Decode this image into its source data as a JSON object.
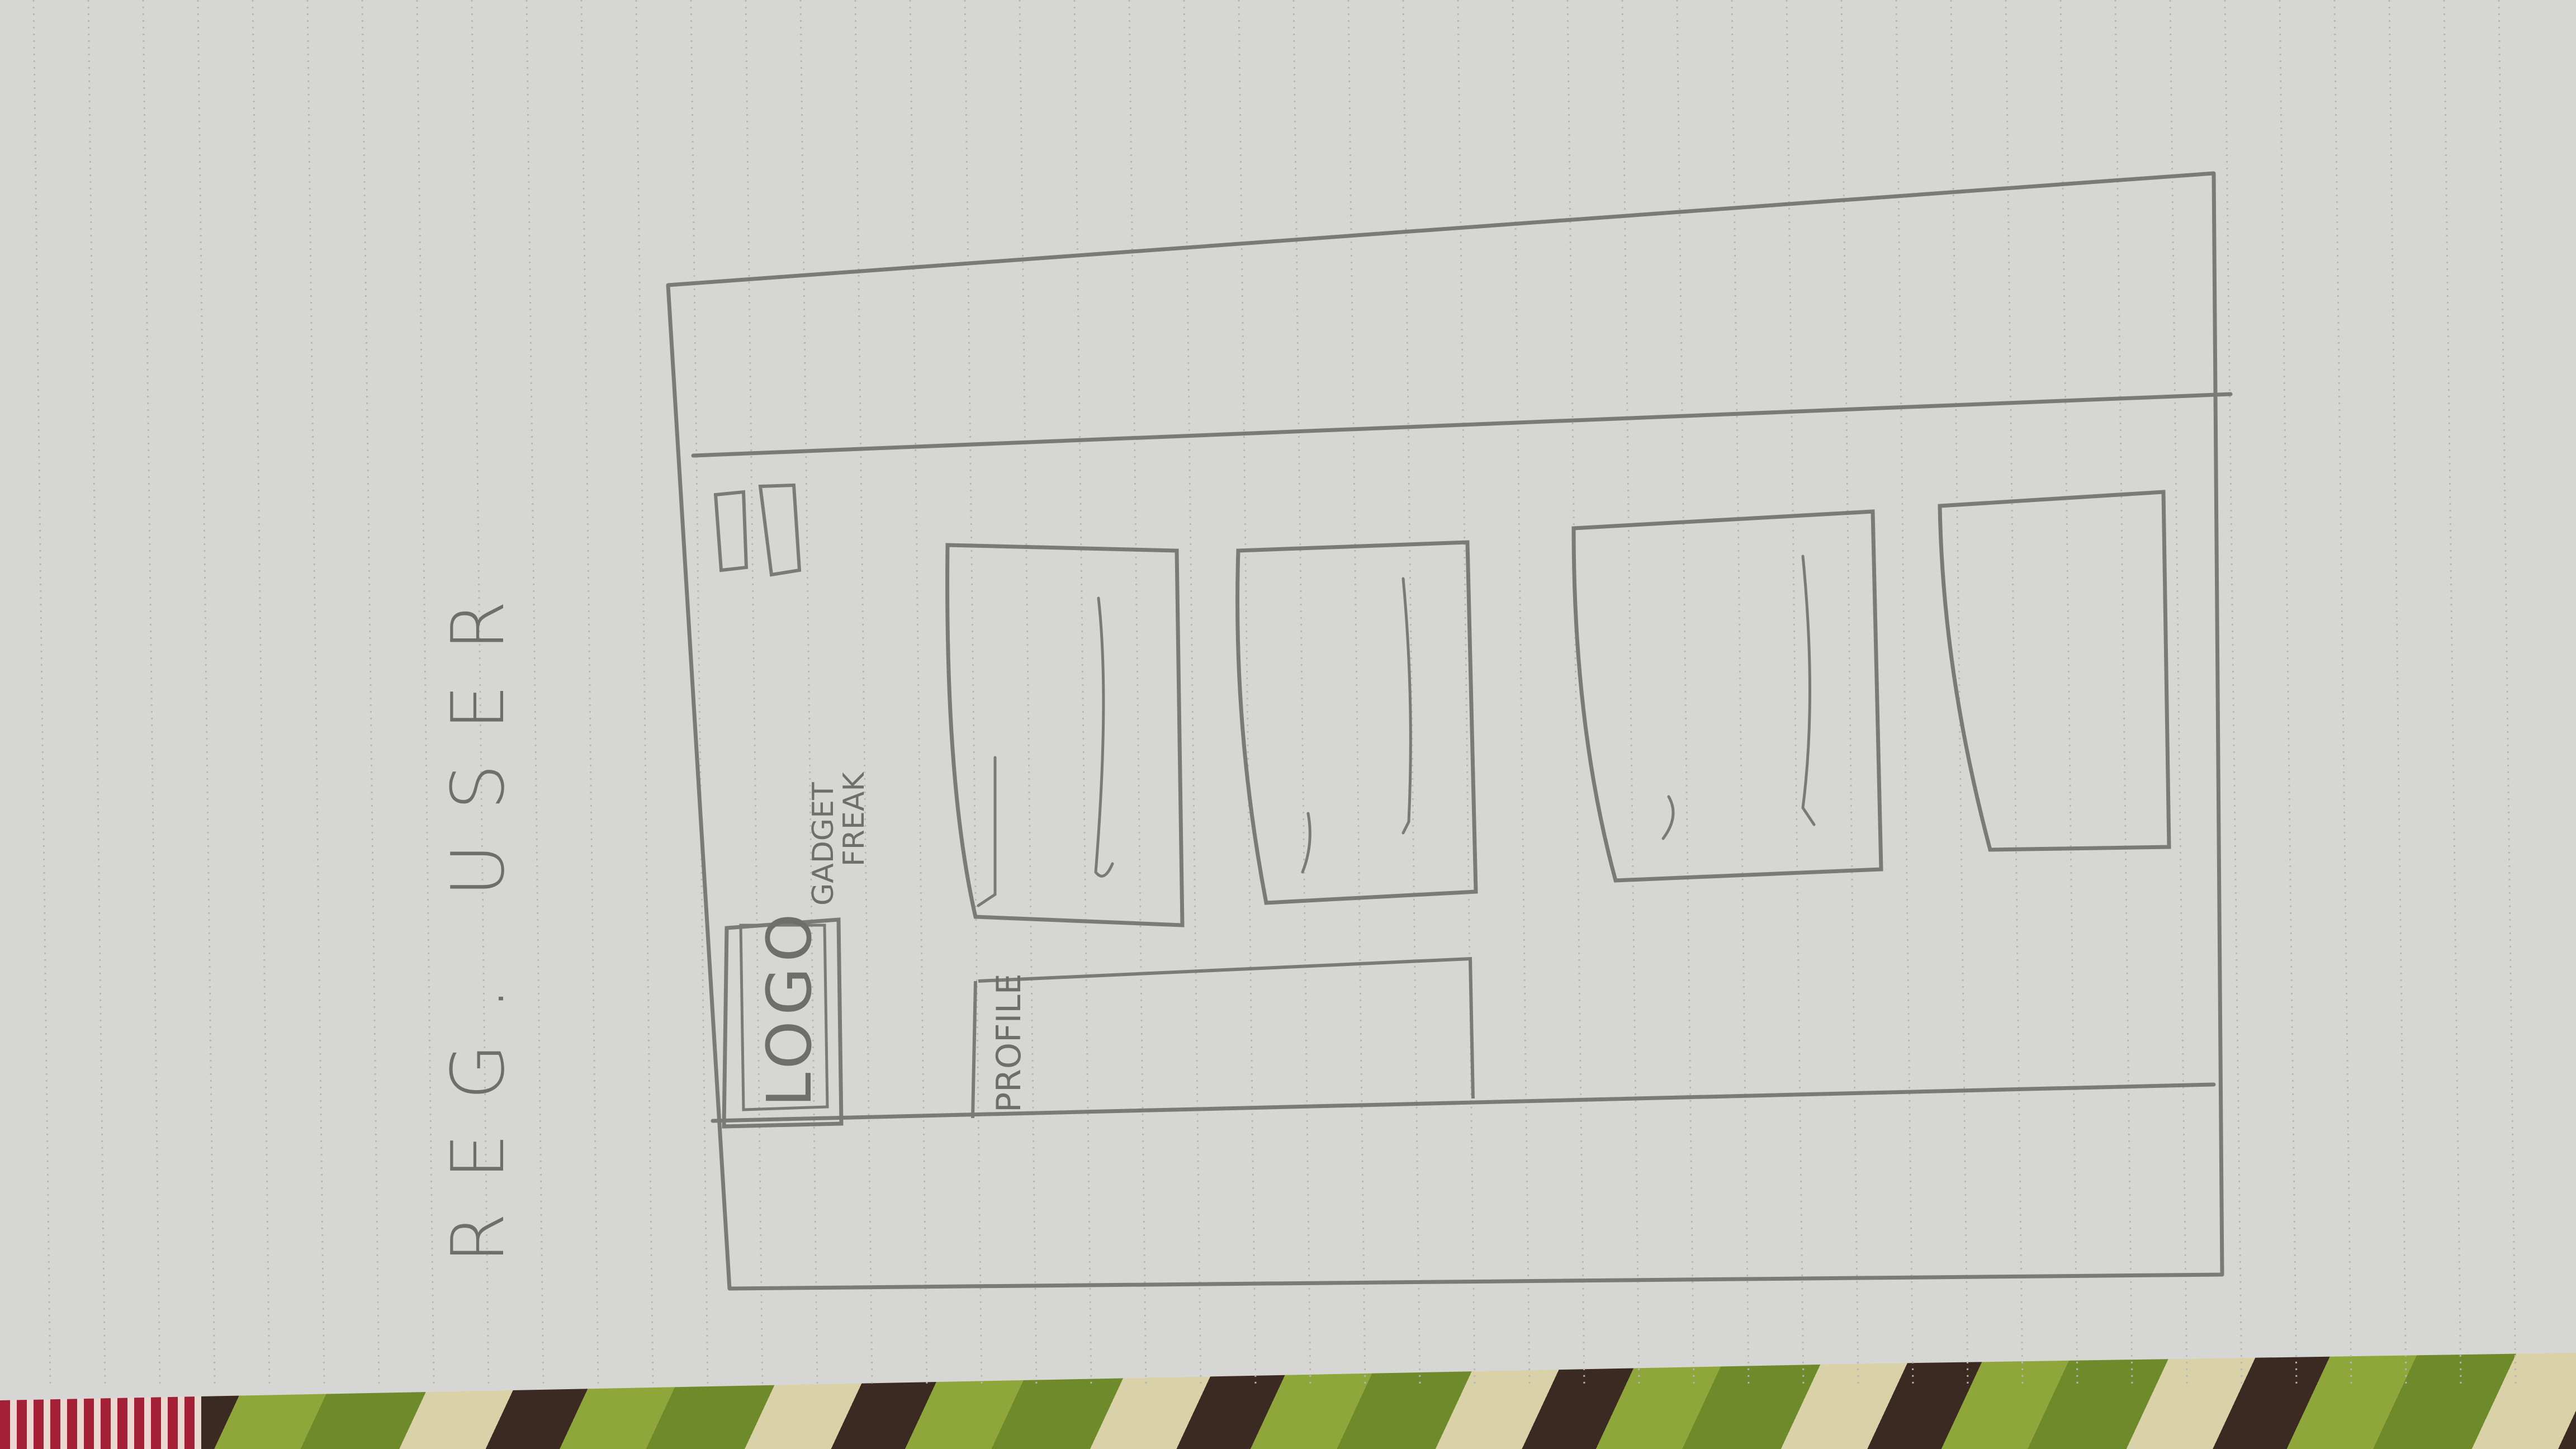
{
  "page_heading": "REG. USER",
  "header": {
    "logo_text": "LOGO",
    "brand_line1": "GADGET",
    "brand_line2": "FREAK"
  },
  "sidebar": {
    "profile_label": "PROFILE"
  },
  "colors": {
    "paper": "#d6d6d4",
    "rule_line": "#b4b4b2",
    "pencil": "#6e6e6c"
  }
}
